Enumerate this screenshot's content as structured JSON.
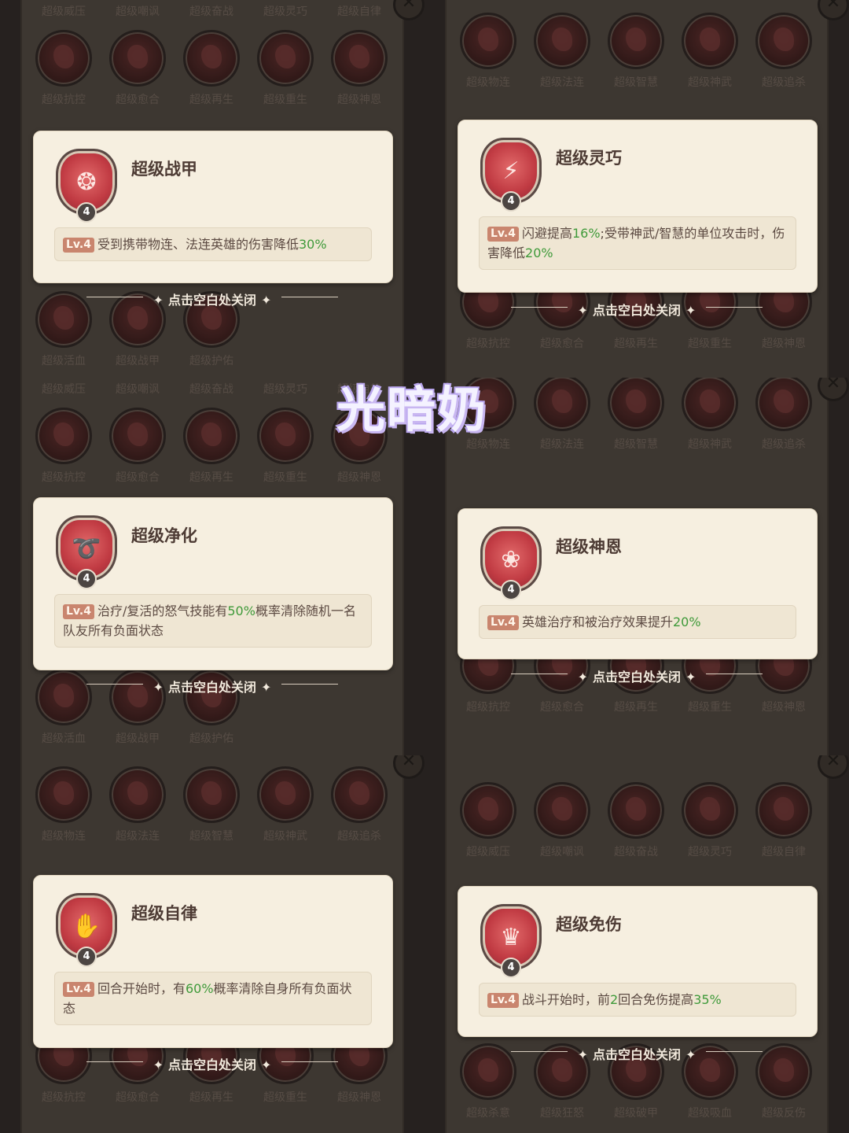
{
  "close_hint": "点击空白处关闭",
  "watermark": "光暗奶",
  "level_badge": "Lv.4",
  "level_num": "4",
  "panels": [
    {
      "rows": [
        {
          "labels": [
            "超级威压",
            "超级嘲讽",
            "超级奋战",
            "超级灵巧",
            "超级自律"
          ]
        },
        {
          "labels": [
            "超级抗控",
            "超级愈合",
            "超级再生",
            "超级重生",
            "超级神恩"
          ]
        },
        {
          "labels": [
            "超级活血",
            "超级战甲",
            "超级护佑"
          ]
        }
      ],
      "card": {
        "title": "超级战甲",
        "desc_parts": [
          "受到携带物连、法连英雄的伤害降低",
          "30%",
          ""
        ],
        "icon": "armor-icon"
      }
    },
    {
      "rows": [
        {
          "labels": [
            "超级物连",
            "超级法连",
            "超级智慧",
            "超级神武",
            "超级追杀"
          ]
        },
        {
          "labels": [
            "超级抗控",
            "超级愈合",
            "超级再生",
            "超级重生",
            "超级神恩"
          ]
        }
      ],
      "card": {
        "title": "超级灵巧",
        "desc_parts": [
          "闪避提高",
          "16%",
          ";受带神武/智慧的单位攻击时，伤害降低",
          "20%",
          ""
        ],
        "icon": "agility-icon"
      }
    },
    {
      "rows": [
        {
          "labels": [
            "超级威压",
            "超级嘲讽",
            "超级奋战",
            "超级灵巧",
            "超级自律"
          ]
        },
        {
          "labels": [
            "超级抗控",
            "超级愈合",
            "超级再生",
            "超级重生",
            "超级神恩"
          ]
        },
        {
          "labels": [
            "超级活血",
            "超级战甲",
            "超级护佑"
          ]
        }
      ],
      "card": {
        "title": "超级净化",
        "desc_parts": [
          "治疗/复活的怒气技能有",
          "50%",
          "概率清除随机一名队友所有负面状态"
        ],
        "icon": "purify-icon"
      }
    },
    {
      "rows": [
        {
          "labels": [
            "超级物连",
            "超级法连",
            "超级智慧",
            "超级神武",
            "超级追杀"
          ]
        },
        {
          "labels": [
            "超级抗控",
            "超级愈合",
            "超级再生",
            "超级重生",
            "超级神恩"
          ]
        }
      ],
      "card": {
        "title": "超级神恩",
        "desc_parts": [
          "英雄治疗和被治疗效果提升",
          "20%",
          ""
        ],
        "icon": "lotus-icon"
      }
    },
    {
      "rows": [
        {
          "labels": [
            "超级物连",
            "超级法连",
            "超级智慧",
            "超级神武",
            "超级追杀"
          ]
        },
        {
          "labels": [
            "超级抗控",
            "超级愈合",
            "超级再生",
            "超级重生",
            "超级神恩"
          ]
        }
      ],
      "card": {
        "title": "超级自律",
        "desc_parts": [
          "回合开始时，有",
          "60%",
          "概率清除自身所有负面状态"
        ],
        "icon": "discipline-icon"
      }
    },
    {
      "rows": [
        {
          "labels": [
            "超级威压",
            "超级嘲讽",
            "超级奋战",
            "超级灵巧",
            "超级自律"
          ]
        },
        {
          "labels": [
            "超级杀意",
            "超级狂怒",
            "超级破甲",
            "超级吸血",
            "超级反伤"
          ]
        }
      ],
      "card": {
        "title": "超级免伤",
        "desc_parts": [
          "战斗开始时，前",
          "2",
          "回合免伤提高",
          "35%",
          ""
        ],
        "icon": "immunity-icon"
      }
    }
  ]
}
